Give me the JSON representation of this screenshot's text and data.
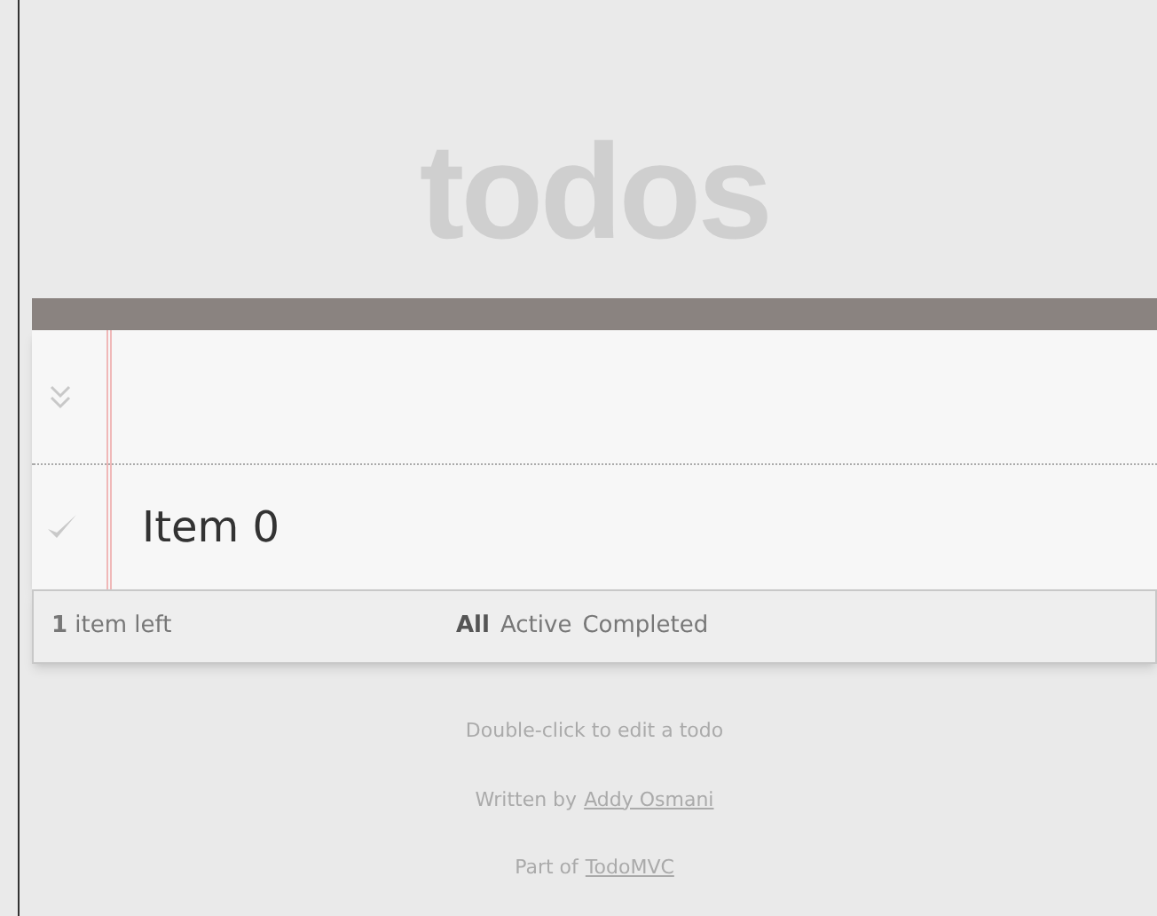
{
  "header": {
    "title": "todos"
  },
  "new_todo": {
    "toggle_all": {
      "checked": false
    }
  },
  "todos": [
    {
      "label": "Item 0",
      "completed": false
    }
  ],
  "footer": {
    "count": "**1** item left",
    "filters": [
      {
        "label": "All",
        "selected": true
      },
      {
        "label": "Active",
        "selected": false
      },
      {
        "label": "Completed",
        "selected": false
      }
    ]
  },
  "info": {
    "hint": "Double-click to edit a todo",
    "written_by": "Written by",
    "author": "Addy Osmani",
    "part_of": "Part of",
    "project": "TodoMVC"
  }
}
